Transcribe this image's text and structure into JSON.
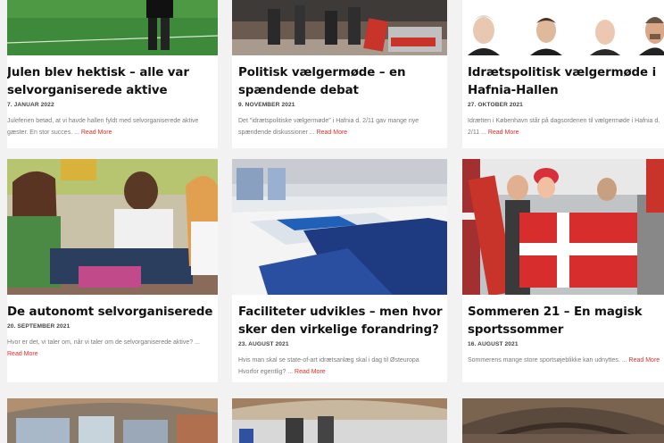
{
  "cards": [
    {
      "title": "Julen blev hektisk – alle var selvorganiserede aktive",
      "date": "7. JANUAR 2022",
      "excerpt": "Juleferien betød, at vi havde hallen fyldt med selvorganiserede aktive gæster. En stor succes. ...",
      "more": "Read More"
    },
    {
      "title": "Politisk vælgermøde – en spændende debat",
      "date": "9. NOVEMBER 2021",
      "excerpt": "Det \"idrætspolitiske vælgermøde\" i Hafnia d. 2/11 gav mange nye spændende diskussioner ...",
      "more": "Read More"
    },
    {
      "title": "Idrætspolitisk vælgermøde i Hafnia-Hallen",
      "date": "27. OKTOBER 2021",
      "excerpt": "Idrætten i København står på dagsordenen til vælgermøde i Hafnia d. 2/11 ...",
      "more": "Read More"
    },
    {
      "title": "De autonomt selvorganiserede",
      "date": "20. SEPTEMBER 2021",
      "excerpt": "Hvor er det, vi taler om, når vi taler om de selvorganiserede aktive? ...",
      "more": "Read More"
    },
    {
      "title": "Faciliteter udvikles – men hvor sker den virkelige forandring?",
      "date": "23. AUGUST 2021",
      "excerpt": "Hvis man skal se state-of-art idrætsanlæg skal i dag til Østeuropa Hvorfor egentlig? ...",
      "more": "Read More"
    },
    {
      "title": "Sommeren 21 – En magisk sportssommer",
      "date": "16. AUGUST 2021",
      "excerpt": "Sommerens mange store sportsøjeblikke kan udnyttes. ...",
      "more": "Read More"
    }
  ]
}
